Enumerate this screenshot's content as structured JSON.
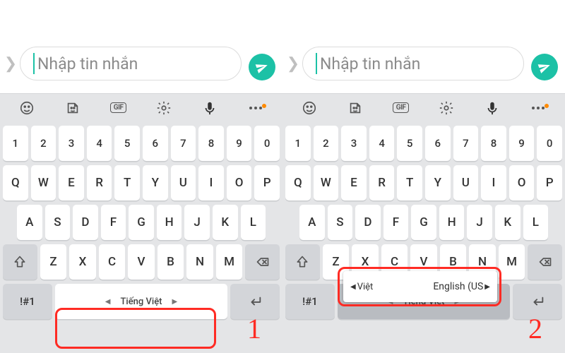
{
  "compose": {
    "placeholder": "Nhập tin nhắn"
  },
  "numbers": [
    "1",
    "2",
    "3",
    "4",
    "5",
    "6",
    "7",
    "8",
    "9",
    "0"
  ],
  "row_q": [
    "Q",
    "W",
    "E",
    "R",
    "T",
    "Y",
    "U",
    "I",
    "O",
    "P"
  ],
  "row_a": [
    "A",
    "S",
    "D",
    "F",
    "G",
    "H",
    "J",
    "K",
    "L"
  ],
  "row_z": [
    "Z",
    "X",
    "C",
    "V",
    "B",
    "N",
    "M"
  ],
  "sym_label": "!#1",
  "space_label": "Tiếng Việt",
  "step1": "1",
  "step2": "2",
  "lang_popup": {
    "left": "Việt",
    "right": "English (US"
  },
  "toolbar_gif": "GIF"
}
